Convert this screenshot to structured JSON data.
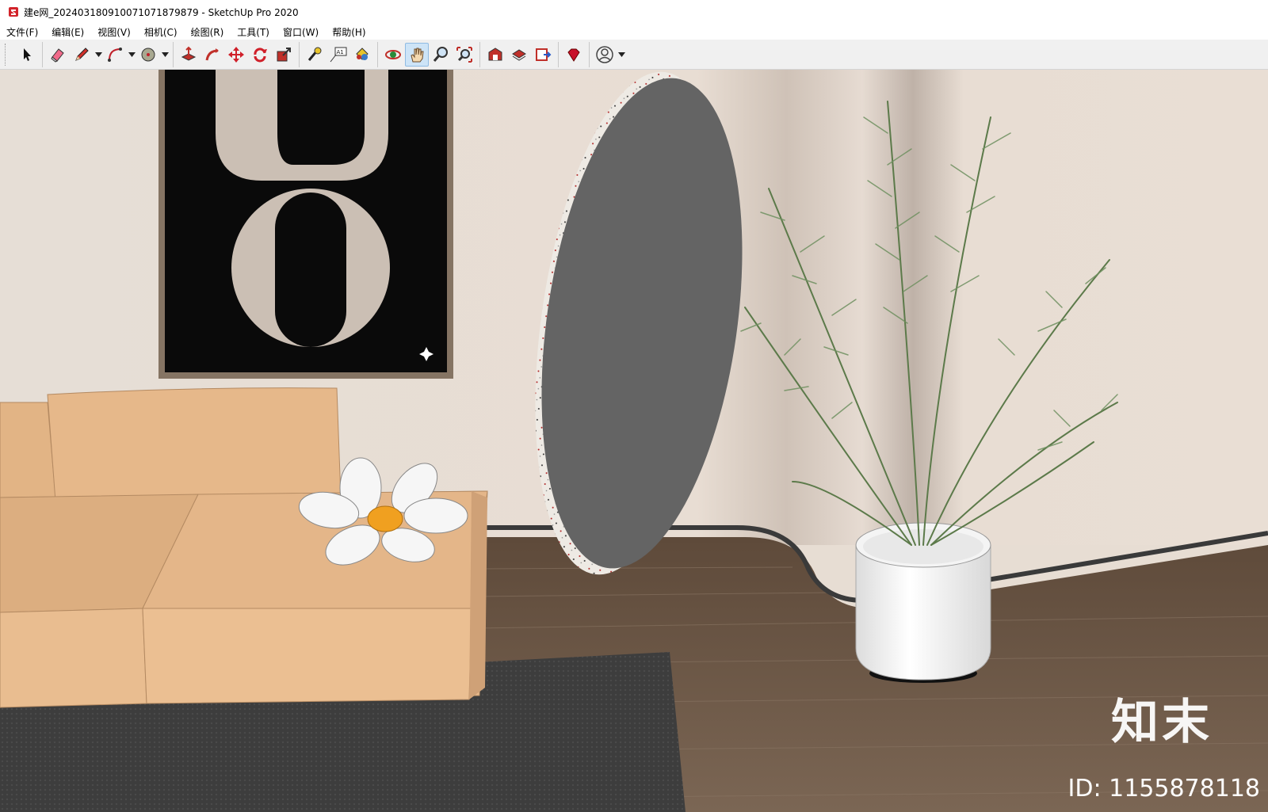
{
  "window": {
    "title": "建e网_20240318091007107187​9879 - SketchUp Pro 2020"
  },
  "menu": {
    "items": [
      {
        "label": "文件(F)"
      },
      {
        "label": "编辑(E)"
      },
      {
        "label": "视图(V)"
      },
      {
        "label": "相机(C)"
      },
      {
        "label": "绘图(R)"
      },
      {
        "label": "工具(T)"
      },
      {
        "label": "窗口(W)"
      },
      {
        "label": "帮助(H)"
      }
    ]
  },
  "toolbar": {
    "tools": [
      {
        "name": "select-icon"
      },
      {
        "name": "eraser-icon"
      },
      {
        "name": "pencil-icon"
      },
      {
        "name": "arc-icon"
      },
      {
        "name": "shape-icon"
      },
      {
        "name": "push-pull-icon"
      },
      {
        "name": "follow-me-icon"
      },
      {
        "name": "move-icon"
      },
      {
        "name": "rotate-icon"
      },
      {
        "name": "scale-icon"
      },
      {
        "name": "tape-measure-icon"
      },
      {
        "name": "text-icon"
      },
      {
        "name": "paint-bucket-icon"
      },
      {
        "name": "orbit-icon"
      },
      {
        "name": "pan-icon",
        "active": true
      },
      {
        "name": "zoom-icon"
      },
      {
        "name": "zoom-extents-icon"
      },
      {
        "name": "warehouse-icon"
      },
      {
        "name": "extension-warehouse-icon"
      },
      {
        "name": "send-to-layout-icon"
      },
      {
        "name": "ruby-icon"
      },
      {
        "name": "account-icon"
      }
    ],
    "text_tool_label": "A1"
  },
  "watermark": {
    "brand": "知末",
    "id_text": "ID: 1155878118"
  },
  "colors": {
    "wall": "#e7ddd3",
    "floor": "#6e5a48",
    "sofa": "#e6b88a",
    "rug": "#3c3c3c",
    "mirror": "#646464",
    "poster": "#0a0a0a",
    "accent": "#f0a020"
  }
}
